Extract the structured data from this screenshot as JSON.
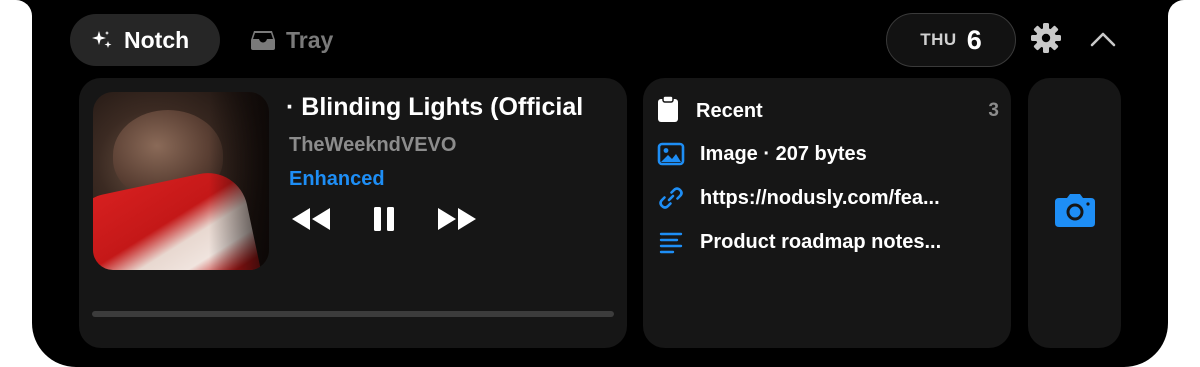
{
  "tabs": [
    {
      "label": "Notch",
      "icon": "sparkles-icon",
      "selected": true
    },
    {
      "label": "Tray",
      "icon": "tray-icon",
      "selected": false
    }
  ],
  "date": {
    "weekday": "THU",
    "day": "6"
  },
  "toolbar": {
    "settings_icon": "gear-icon",
    "collapse_icon": "chevron-up-icon"
  },
  "media": {
    "title": "· Blinding Lights (Official",
    "artist": "TheWeekndVEVO",
    "tag": "Enhanced",
    "controls": [
      "rewind-icon",
      "pause-icon",
      "fast-forward-icon"
    ]
  },
  "recent": {
    "title": "Recent",
    "count": "3",
    "items": [
      {
        "icon": "image-icon",
        "label": "Image · 207 bytes"
      },
      {
        "icon": "link-icon",
        "label": "https://nodusly.com/fea..."
      },
      {
        "icon": "text-lines-icon",
        "label": "Product roadmap notes..."
      }
    ]
  },
  "camera": {
    "icon": "camera-icon"
  },
  "colors": {
    "accent": "#1e8ef5",
    "background": "#000000",
    "card": "#161616"
  }
}
